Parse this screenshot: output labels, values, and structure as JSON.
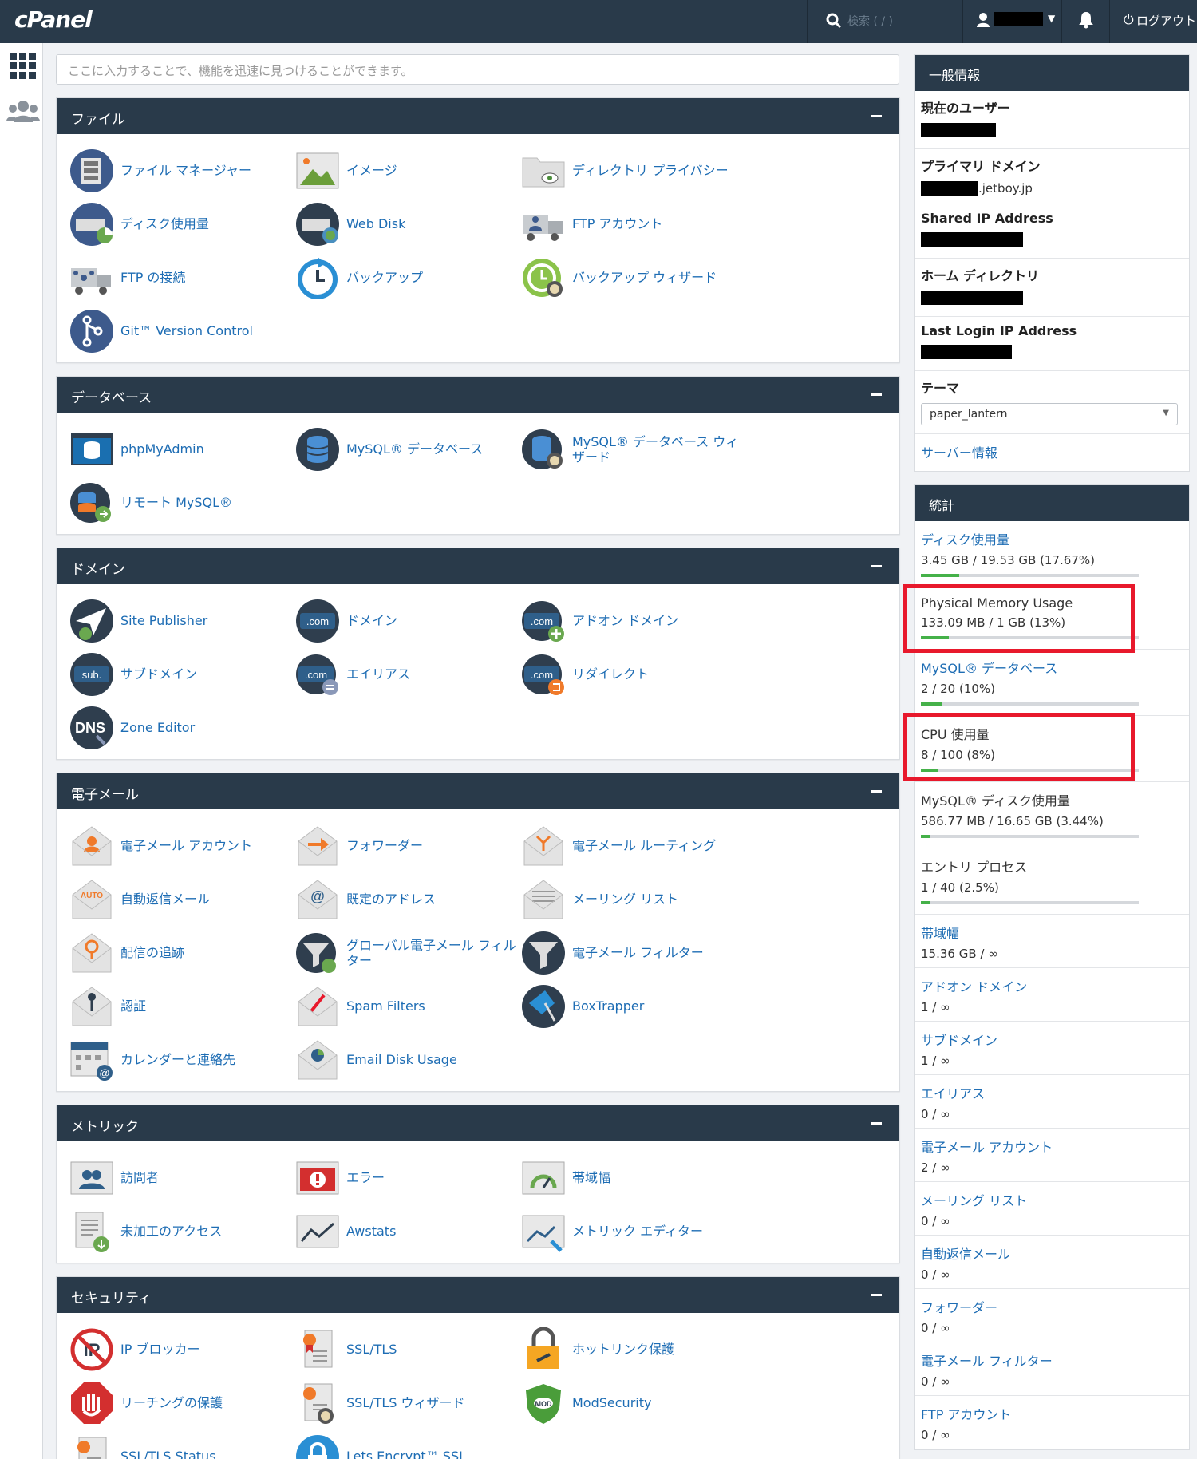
{
  "header": {
    "logo": "cPanel",
    "search_placeholder": "検索 ( / )",
    "logout_label": "ログアウト"
  },
  "quickfind": {
    "placeholder": "ここに入力することで、機能を迅速に見つけることができます。"
  },
  "sections": {
    "files": {
      "title": "ファイル",
      "items": [
        "ファイル マネージャー",
        "イメージ",
        "ディレクトリ プライバシー",
        "ディスク使用量",
        "Web Disk",
        "FTP アカウント",
        "FTP の接続",
        "バックアップ",
        "バックアップ ウィザード",
        "Git™ Version Control"
      ]
    },
    "databases": {
      "title": "データベース",
      "items": [
        "phpMyAdmin",
        "MySQL® データベース",
        "MySQL® データベース ウィザード",
        "リモート MySQL®"
      ]
    },
    "domains": {
      "title": "ドメイン",
      "items": [
        "Site Publisher",
        "ドメイン",
        "アドオン ドメイン",
        "サブドメイン",
        "エイリアス",
        "リダイレクト",
        "Zone Editor"
      ]
    },
    "email": {
      "title": "電子メール",
      "items": [
        "電子メール アカウント",
        "フォワーダー",
        "電子メール ルーティング",
        "自動返信メール",
        "既定のアドレス",
        "メーリング リスト",
        "配信の追跡",
        "グローバル電子メール フィルター",
        "電子メール フィルター",
        "認証",
        "Spam Filters",
        "BoxTrapper",
        "カレンダーと連絡先",
        "Email Disk Usage"
      ]
    },
    "metrics": {
      "title": "メトリック",
      "items": [
        "訪問者",
        "エラー",
        "帯域幅",
        "未加工のアクセス",
        "Awstats",
        "メトリック エディター"
      ]
    },
    "security": {
      "title": "セキュリティ",
      "items": [
        "IP ブロッカー",
        "SSL/TLS",
        "ホットリンク保護",
        "リーチングの保護",
        "SSL/TLS ウィザード",
        "ModSecurity",
        "SSL/TLS Status",
        "Lets Encrypt™ SSL"
      ]
    }
  },
  "general_info": {
    "title": "一般情報",
    "current_user_label": "現在のユーザー",
    "primary_domain_label": "プライマリ ドメイン",
    "primary_domain_suffix": ".jetboy.jp",
    "shared_ip_label": "Shared IP Address",
    "home_dir_label": "ホーム ディレクトリ",
    "last_login_label": "Last Login IP Address",
    "theme_label": "テーマ",
    "theme_value": "paper_lantern",
    "server_info_link": "サーバー情報"
  },
  "stats": {
    "title": "統計",
    "items": [
      {
        "label": "ディスク使用量",
        "value": "3.45 GB / 19.53 GB   (17.67%)",
        "percent": 17.67,
        "link": true
      },
      {
        "label": "Physical Memory Usage",
        "value": "133.09 MB / 1 GB   (13%)",
        "percent": 13,
        "link": false
      },
      {
        "label": "MySQL® データベース",
        "value": "2 / 20   (10%)",
        "percent": 10,
        "link": true
      },
      {
        "label": "CPU 使用量",
        "value": "8 / 100   (8%)",
        "percent": 8,
        "link": false
      },
      {
        "label": "MySQL® ディスク使用量",
        "value": "586.77 MB / 16.65 GB   (3.44%)",
        "percent": 3.44,
        "link": false
      },
      {
        "label": "エントリ プロセス",
        "value": "1 / 40   (2.5%)",
        "percent": 2.5,
        "link": false
      },
      {
        "label": "帯域幅",
        "value": "15.36 GB / ∞",
        "link": true
      },
      {
        "label": "アドオン ドメイン",
        "value": "1 / ∞",
        "link": true
      },
      {
        "label": "サブドメイン",
        "value": "1 / ∞",
        "link": true
      },
      {
        "label": "エイリアス",
        "value": "0 / ∞",
        "link": true
      },
      {
        "label": "電子メール アカウント",
        "value": "2 / ∞",
        "link": true
      },
      {
        "label": "メーリング リスト",
        "value": "0 / ∞",
        "link": true
      },
      {
        "label": "自動返信メール",
        "value": "0 / ∞",
        "link": true
      },
      {
        "label": "フォワーダー",
        "value": "0 / ∞",
        "link": true
      },
      {
        "label": "電子メール フィルター",
        "value": "0 / ∞",
        "link": true
      },
      {
        "label": "FTP アカウント",
        "value": "0 / ∞",
        "link": true
      }
    ]
  },
  "colors": {
    "header": "#293a4a",
    "link": "#1e6db4",
    "bar_fill": "#45b149",
    "highlight": "#e8192c"
  }
}
